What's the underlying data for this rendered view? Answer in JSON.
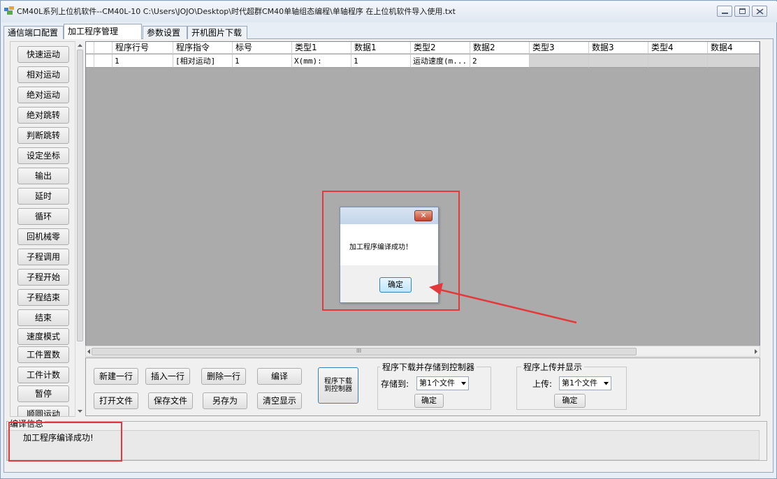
{
  "window": {
    "title": "CM40L系列上位机软件--CM40L-10   C:\\Users\\JOJO\\Desktop\\时代超群CM40单轴组态编程\\单轴程序 在上位机软件导入使用.txt"
  },
  "tabs": [
    "通信端口配置",
    "加工程序管理",
    "参数设置",
    "开机图片下载"
  ],
  "toolbox": [
    "快速运动",
    "相对运动",
    "绝对运动",
    "绝对跳转",
    "判断跳转",
    "设定坐标",
    "输出",
    "延时",
    "循环",
    "回机械零",
    "子程调用",
    "子程开始",
    "子程结束",
    "结束",
    "速度模式",
    "工件置数",
    "工件计数",
    "暂停",
    "顺圆运动"
  ],
  "grid": {
    "headers": [
      "程序行号",
      "程序指令",
      "标号",
      "类型1",
      "数据1",
      "类型2",
      "数据2",
      "类型3",
      "数据3",
      "类型4",
      "数据4"
    ],
    "rows": [
      [
        "1",
        "[相对运动]",
        "1",
        "X(mm):",
        "1",
        "运动速度(m...",
        "2",
        "",
        "",
        "",
        ""
      ]
    ],
    "hscroll_glyph": "III"
  },
  "buttons": {
    "new_row": "新建一行",
    "insert_row": "插入一行",
    "delete_row": "删除一行",
    "compile": "编译",
    "open_file": "打开文件",
    "save_file": "保存文件",
    "save_as": "另存为",
    "clear_display": "清空显示",
    "download_line1": "程序下载",
    "download_line2": "到控制器"
  },
  "download_group": {
    "title": "程序下载并存储到控制器",
    "label": "存储到:",
    "selected": "第1个文件",
    "confirm": "确定"
  },
  "upload_group": {
    "title": "程序上传并显示",
    "label": "上传:",
    "selected": "第1个文件",
    "confirm": "确定"
  },
  "info": {
    "title": "编译信息",
    "message": "加工程序编译成功!"
  },
  "dialog": {
    "message": "加工程序编译成功！",
    "ok": "确定",
    "close_glyph": "✕"
  },
  "colors": {
    "annotation": "#e23a3a"
  }
}
